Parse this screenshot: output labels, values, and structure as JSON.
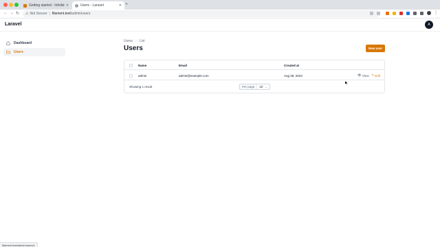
{
  "browser": {
    "tabs": [
      {
        "label": "Getting started - Infolist Buil...",
        "active": false
      },
      {
        "label": "Users - Laravel",
        "active": true
      }
    ],
    "url": {
      "security": "Not Secure",
      "host": "filament.test",
      "path": "/admin/users"
    },
    "status_url": "filament.test/admin/users/1"
  },
  "app": {
    "brand": "Laravel",
    "avatar_initial": "A"
  },
  "sidebar": {
    "items": [
      {
        "label": "Dashboard",
        "icon": "home-icon",
        "active": false
      },
      {
        "label": "Users",
        "icon": "folder-icon",
        "active": true
      }
    ]
  },
  "breadcrumb": [
    "Users",
    "List"
  ],
  "page": {
    "title": "Users",
    "new_button": "New user"
  },
  "table": {
    "columns": [
      "Name",
      "Email",
      "Created at"
    ],
    "rows": [
      {
        "name": "admin",
        "email": "admin@example.com",
        "created_at": "Aug 28, 2023"
      }
    ],
    "row_actions": {
      "view": "View",
      "edit": "Edit"
    },
    "summary": "Showing 1 result",
    "per_page_label": "Per page",
    "per_page_value": "10"
  },
  "colors": {
    "accent": "#d97706",
    "text": "#111827"
  }
}
